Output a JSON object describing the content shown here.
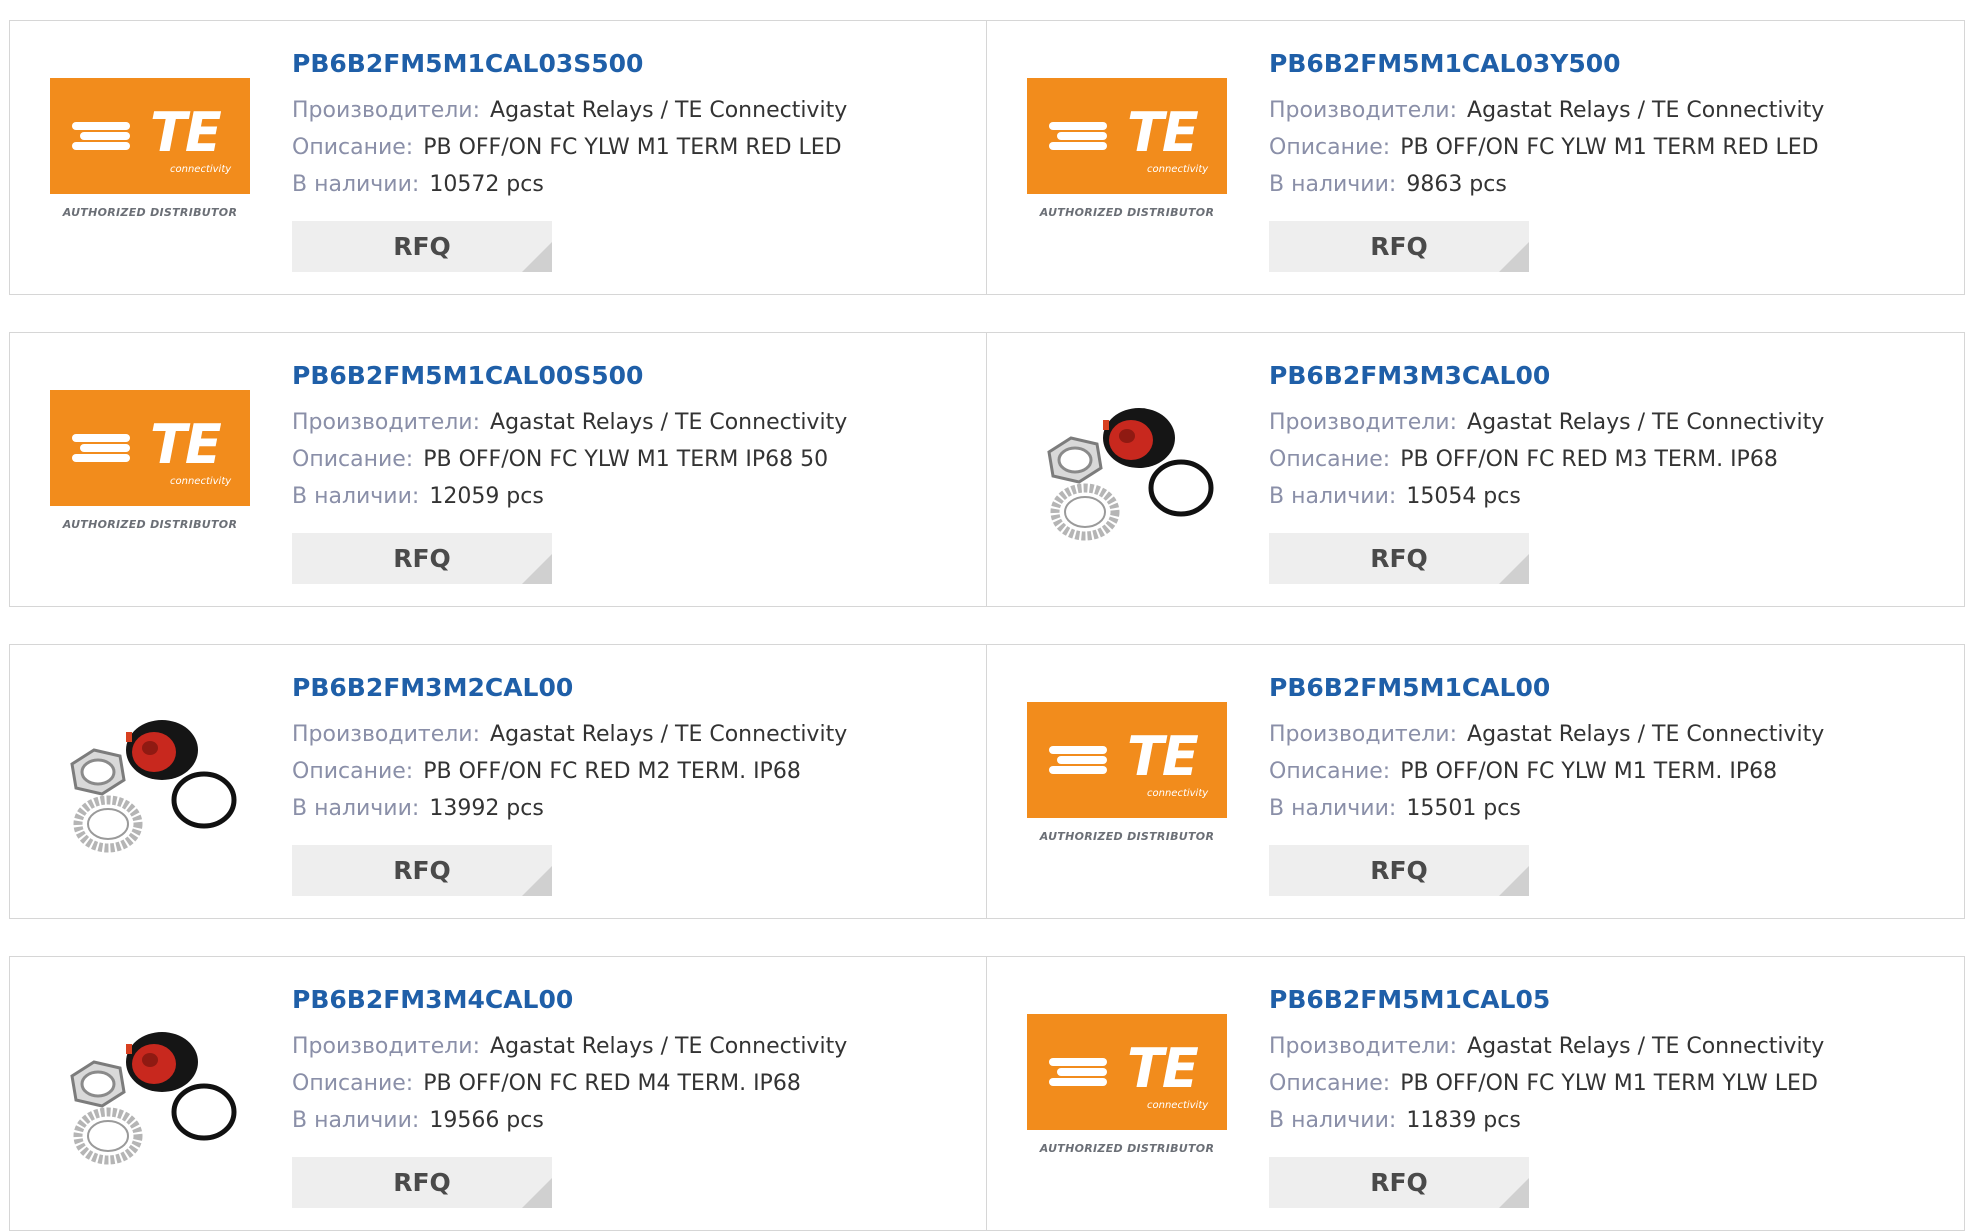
{
  "labels": {
    "manufacturer": "Производители:",
    "description": "Описание:",
    "stock": "В наличии:",
    "rfq": "RFQ"
  },
  "logo": {
    "letters": "TE",
    "sub": "connectivity",
    "tag": "AUTHORIZED DISTRIBUTOR"
  },
  "colors": {
    "part_link": "#1f5fa8",
    "te_orange": "#f28c1c",
    "label_gray": "#8a8fa8"
  },
  "products": [
    {
      "part": "PB6B2FM5M1CAL03S500",
      "manufacturer": "Agastat Relays / TE Connectivity",
      "description": "PB OFF/ON FC YLW M1 TERM RED LED",
      "stock": "10572 pcs",
      "image": "te-logo"
    },
    {
      "part": "PB6B2FM5M1CAL03Y500",
      "manufacturer": "Agastat Relays / TE Connectivity",
      "description": "PB OFF/ON FC YLW M1 TERM RED LED",
      "stock": "9863 pcs",
      "image": "te-logo"
    },
    {
      "part": "PB6B2FM5M1CAL00S500",
      "manufacturer": "Agastat Relays / TE Connectivity",
      "description": "PB OFF/ON FC YLW M1 TERM IP68 50",
      "stock": "12059 pcs",
      "image": "te-logo"
    },
    {
      "part": "PB6B2FM3M3CAL00",
      "manufacturer": "Agastat Relays / TE Connectivity",
      "description": "PB OFF/ON FC RED M3 TERM. IP68",
      "stock": "15054 pcs",
      "image": "pushbutton-photo"
    },
    {
      "part": "PB6B2FM3M2CAL00",
      "manufacturer": "Agastat Relays / TE Connectivity",
      "description": "PB OFF/ON FC RED M2 TERM. IP68",
      "stock": "13992 pcs",
      "image": "pushbutton-photo"
    },
    {
      "part": "PB6B2FM5M1CAL00",
      "manufacturer": "Agastat Relays / TE Connectivity",
      "description": "PB OFF/ON FC YLW M1 TERM. IP68",
      "stock": "15501 pcs",
      "image": "te-logo"
    },
    {
      "part": "PB6B2FM3M4CAL00",
      "manufacturer": "Agastat Relays / TE Connectivity",
      "description": "PB OFF/ON FC RED M4 TERM. IP68",
      "stock": "19566 pcs",
      "image": "pushbutton-photo"
    },
    {
      "part": "PB6B2FM5M1CAL05",
      "manufacturer": "Agastat Relays / TE Connectivity",
      "description": "PB OFF/ON FC YLW M1 TERM YLW LED",
      "stock": "11839 pcs",
      "image": "te-logo"
    }
  ]
}
